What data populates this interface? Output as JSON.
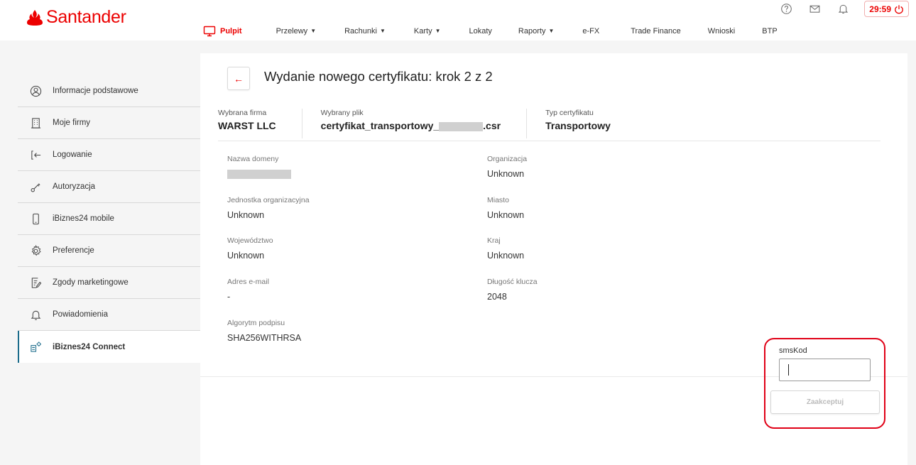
{
  "brand": {
    "name": "Santander",
    "color": "#ec0000"
  },
  "header": {
    "icons": [
      "help-icon",
      "mail-icon",
      "bell-icon"
    ],
    "timer": "29:59"
  },
  "nav": {
    "items": [
      {
        "label": "Pulpit",
        "active": true,
        "dropdown": false
      },
      {
        "label": "Przelewy",
        "active": false,
        "dropdown": true
      },
      {
        "label": "Rachunki",
        "active": false,
        "dropdown": true
      },
      {
        "label": "Karty",
        "active": false,
        "dropdown": true
      },
      {
        "label": "Lokaty",
        "active": false,
        "dropdown": false
      },
      {
        "label": "Raporty",
        "active": false,
        "dropdown": true
      },
      {
        "label": "e-FX",
        "active": false,
        "dropdown": false
      },
      {
        "label": "Trade Finance",
        "active": false,
        "dropdown": false
      },
      {
        "label": "Wnioski",
        "active": false,
        "dropdown": false
      },
      {
        "label": "BTP",
        "active": false,
        "dropdown": false
      }
    ]
  },
  "sidebar": {
    "items": [
      {
        "label": "Informacje podstawowe",
        "icon": "user-circle-icon"
      },
      {
        "label": "Moje firmy",
        "icon": "building-icon"
      },
      {
        "label": "Logowanie",
        "icon": "login-icon"
      },
      {
        "label": "Autoryzacja",
        "icon": "key-icon"
      },
      {
        "label": "iBiznes24 mobile",
        "icon": "phone-icon"
      },
      {
        "label": "Preferencje",
        "icon": "gear-icon"
      },
      {
        "label": "Zgody marketingowe",
        "icon": "document-edit-icon"
      },
      {
        "label": "Powiadomienia",
        "icon": "bell-icon"
      },
      {
        "label": "iBiznes24 Connect",
        "icon": "connect-icon",
        "active": true
      }
    ]
  },
  "main": {
    "title": "Wydanie nowego certyfikatu: krok 2 z 2",
    "summary": {
      "company_label": "Wybrana firma",
      "company_value": "WARST LLC",
      "file_label": "Wybrany plik",
      "file_prefix": "certyfikat_transportowy_",
      "file_suffix": ".csr",
      "type_label": "Typ certyfikatu",
      "type_value": "Transportowy"
    },
    "fields": {
      "domain_label": "Nazwa domeny",
      "org_label": "Organizacja",
      "org_value": "Unknown",
      "unit_label": "Jednostka organizacyjna",
      "unit_value": "Unknown",
      "city_label": "Miasto",
      "city_value": "Unknown",
      "province_label": "Województwo",
      "province_value": "Unknown",
      "country_label": "Kraj",
      "country_value": "Unknown",
      "email_label": "Adres e-mail",
      "email_value": "-",
      "keylen_label": "Długość klucza",
      "keylen_value": "2048",
      "algo_label": "Algorytm podpisu",
      "algo_value": "SHA256WITHRSA"
    },
    "sms": {
      "label": "smsKod",
      "value": "",
      "accept_label": "Zaakceptuj"
    }
  }
}
